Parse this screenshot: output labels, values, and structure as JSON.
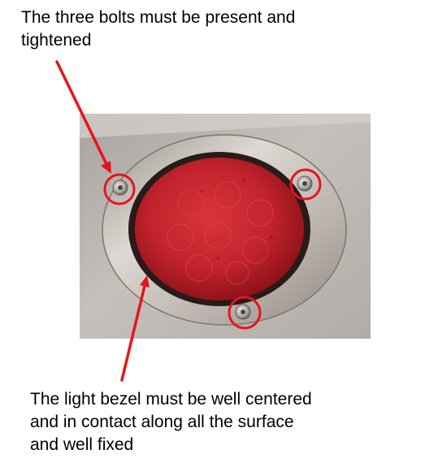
{
  "annotations": {
    "top_note": "The three bolts must be present and\ntightened",
    "bottom_note": "The light bezel must be well centered\nand in contact along all the surface\nand well fixed"
  },
  "colors": {
    "annotation_red": "#e8141b",
    "lens_red": "#c3232c",
    "metal_panel": "#b6b2ad",
    "bezel_steel": "#c9c3bd"
  },
  "photo": {
    "subject": "red-tail-light-with-stainless-bezel",
    "bolt_count": 3
  }
}
